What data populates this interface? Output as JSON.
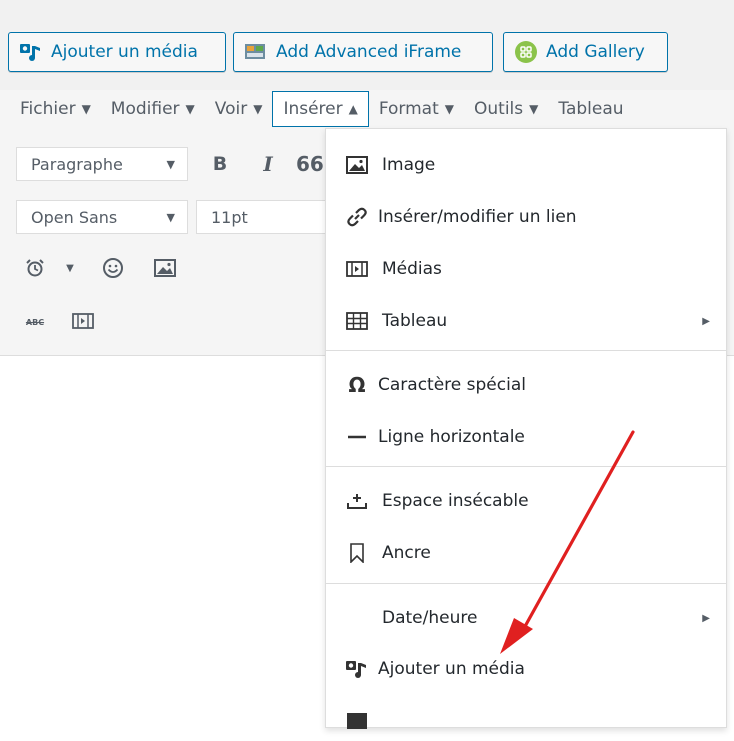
{
  "buttons": {
    "add_media": "Ajouter un média",
    "add_iframe": "Add Advanced iFrame",
    "add_gallery": "Add Gallery"
  },
  "menubar": {
    "items": [
      {
        "label": "Fichier"
      },
      {
        "label": "Modifier"
      },
      {
        "label": "Voir"
      },
      {
        "label": "Insérer"
      },
      {
        "label": "Format"
      },
      {
        "label": "Outils"
      },
      {
        "label": "Tableau"
      }
    ]
  },
  "toolbar": {
    "format_select": "Paragraphe",
    "font_select": "Open Sans",
    "size_select": "11pt",
    "bold": "B",
    "italic": "I",
    "quote": "66",
    "strike_label": "ABC"
  },
  "dropdown": {
    "items": [
      {
        "label": "Image",
        "icon": "image-icon"
      },
      {
        "label": "Insérer/modifier un lien",
        "icon": "link-icon"
      },
      {
        "label": "Médias",
        "icon": "media-icon"
      },
      {
        "label": "Tableau",
        "icon": "table-icon"
      },
      {
        "label": "Caractère spécial",
        "icon": "omega-icon"
      },
      {
        "label": "Ligne horizontale",
        "icon": "hr-icon"
      },
      {
        "label": "Espace insécable",
        "icon": "nbsp-icon"
      },
      {
        "label": "Ancre",
        "icon": "anchor-icon"
      },
      {
        "label": "Date/heure",
        "icon": ""
      },
      {
        "label": "Ajouter un média",
        "icon": "add-media-icon"
      }
    ]
  },
  "colors": {
    "accent": "#0073aa",
    "annotation_arrow": "#e02020",
    "gallery_green": "#8bc34a"
  }
}
